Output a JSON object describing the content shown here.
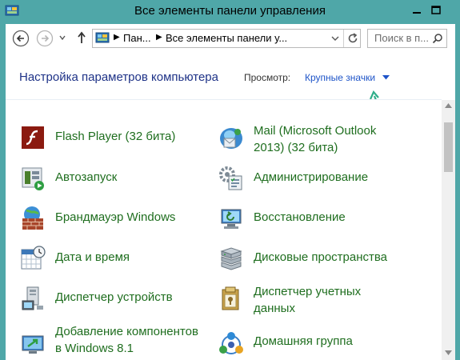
{
  "window": {
    "title": "Все элементы панели управления",
    "icon": "control-panel-icon",
    "frame_color": "#4fa7a8"
  },
  "navbar": {
    "back_icon": "back-arrow-icon",
    "forward_icon": "forward-arrow-icon",
    "recent_icon": "chevron-down-icon",
    "up_icon": "up-arrow-icon",
    "address": {
      "crumbs": [
        "Пан...",
        "Все элементы панели у..."
      ],
      "separator": "▶"
    },
    "search_placeholder": "Поиск в п..."
  },
  "header": {
    "title": "Настройка параметров компьютера",
    "view_label": "Просмотр:",
    "view_value": "Крупные значки",
    "accent_color": "#1e54c8",
    "title_color": "#1e3287"
  },
  "items": [
    {
      "label": "Flash Player (32 бита)",
      "icon": "flash-player-icon"
    },
    {
      "label": "Mail (Microsoft Outlook 2013) (32 бита)",
      "label_line1": "Mail (Microsoft Outlook",
      "label_line2": "2013) (32 бита)",
      "icon": "mail-icon"
    },
    {
      "label": "Автозапуск",
      "icon": "autoplay-icon"
    },
    {
      "label": "Администрирование",
      "icon": "administrative-tools-icon"
    },
    {
      "label": "Брандмауэр Windows",
      "icon": "firewall-icon"
    },
    {
      "label": "Восстановление",
      "icon": "recovery-icon"
    },
    {
      "label": "Дата и время",
      "icon": "calendar-clock-icon"
    },
    {
      "label": "Дисковые пространства",
      "icon": "storage-spaces-icon"
    },
    {
      "label": "Диспетчер устройств",
      "icon": "device-manager-icon"
    },
    {
      "label": "Диспетчер учетных данных",
      "label_line1": "Диспетчер учетных",
      "label_line2": "данных",
      "icon": "credential-manager-icon"
    },
    {
      "label": "Добавление компонентов в Windows 8.1",
      "label_line1": "Добавление компонентов",
      "label_line2": "в Windows 8.1",
      "icon": "add-features-icon"
    },
    {
      "label": "Домашняя группа",
      "icon": "homegroup-icon"
    }
  ],
  "item_color": "#1f6e1f"
}
